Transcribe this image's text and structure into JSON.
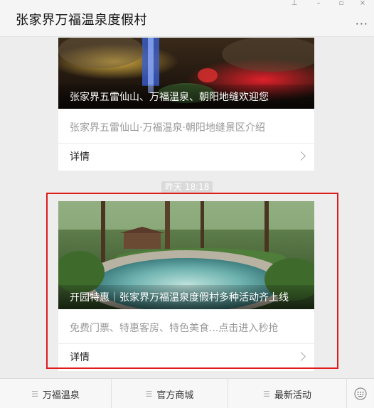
{
  "header": {
    "title": "张家界万福温泉度假村",
    "more_label": "···"
  },
  "articles": [
    {
      "cover_title": "张家界五雷仙山、万福温泉、朝阳地缝欢迎您",
      "digest": "张家界五雷仙山·万福温泉·朝阳地缝景区介绍",
      "detail_label": "详情"
    },
    {
      "cover_title": "开园特惠｜张家界万福温泉度假村多种活动齐上线",
      "digest": "免费门票、特惠客房、特色美食...点击进入秒抢",
      "detail_label": "详情"
    }
  ],
  "timestamp": "昨天 18:18",
  "menu": [
    {
      "label": "万福温泉"
    },
    {
      "label": "官方商城"
    },
    {
      "label": "最新活动"
    }
  ],
  "colors": {
    "highlight": "#e01b1b",
    "background": "#ededed"
  }
}
